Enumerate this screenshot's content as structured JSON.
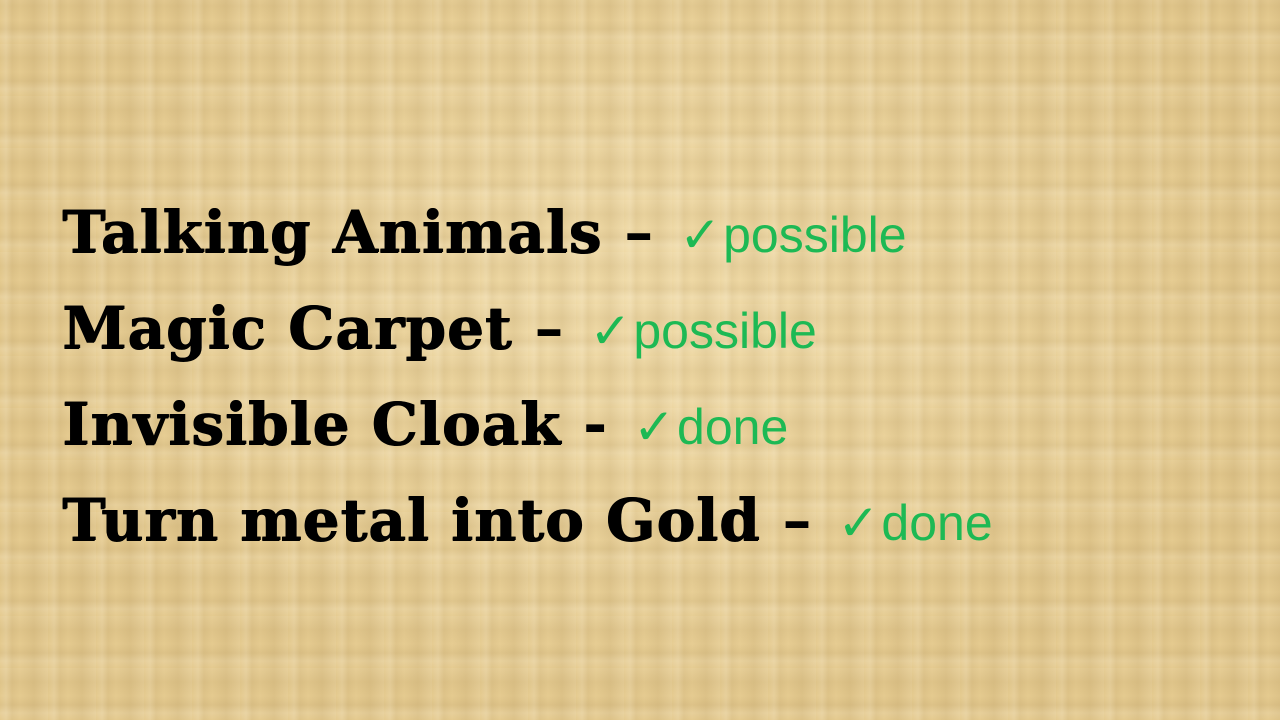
{
  "accent_color": "#1db954",
  "text_color": "#000000",
  "background_color": "#e8cf95",
  "items": [
    {
      "name": "Talking Animals",
      "separator": "–",
      "check": "✓",
      "status": "possible"
    },
    {
      "name": "Magic Carpet",
      "separator": "–",
      "check": "✓",
      "status": "possible"
    },
    {
      "name": "Invisible Cloak",
      "separator": "-",
      "check": "✓",
      "status": "done"
    },
    {
      "name": "Turn metal into Gold",
      "separator": "–",
      "check": "✓",
      "status": "done"
    }
  ]
}
